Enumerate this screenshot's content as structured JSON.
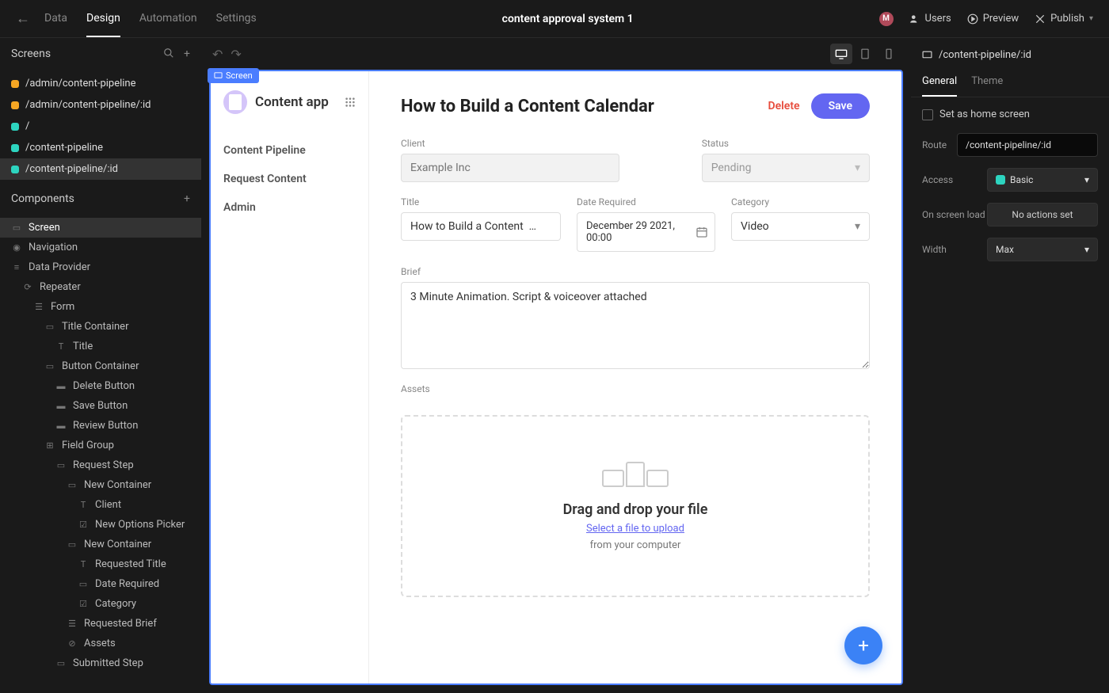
{
  "topbar": {
    "tabs": [
      "Data",
      "Design",
      "Automation",
      "Settings"
    ],
    "active_tab": "Design",
    "title": "content approval system 1",
    "avatar_initial": "M",
    "users_label": "Users",
    "preview_label": "Preview",
    "publish_label": "Publish"
  },
  "left": {
    "screens_header": "Screens",
    "screens": [
      {
        "label": "/admin/content-pipeline",
        "color": "orange"
      },
      {
        "label": "/admin/content-pipeline/:id",
        "color": "orange"
      },
      {
        "label": "/",
        "color": "teal"
      },
      {
        "label": "/content-pipeline",
        "color": "teal"
      },
      {
        "label": "/content-pipeline/:id",
        "color": "teal",
        "selected": true
      }
    ],
    "components_header": "Components",
    "components": [
      {
        "label": "Screen",
        "indent": 0,
        "icon": "▭",
        "selected": true
      },
      {
        "label": "Navigation",
        "indent": 0,
        "icon": "◉"
      },
      {
        "label": "Data Provider",
        "indent": 0,
        "icon": "≡"
      },
      {
        "label": "Repeater",
        "indent": 1,
        "icon": "⟳"
      },
      {
        "label": "Form",
        "indent": 2,
        "icon": "☰"
      },
      {
        "label": "Title Container",
        "indent": 3,
        "icon": "▭"
      },
      {
        "label": "Title",
        "indent": 4,
        "icon": "T"
      },
      {
        "label": "Button Container",
        "indent": 3,
        "icon": "▭"
      },
      {
        "label": "Delete Button",
        "indent": 4,
        "icon": "▬"
      },
      {
        "label": "Save Button",
        "indent": 4,
        "icon": "▬"
      },
      {
        "label": "Review Button",
        "indent": 4,
        "icon": "▬"
      },
      {
        "label": "Field Group",
        "indent": 3,
        "icon": "⊞"
      },
      {
        "label": "Request Step",
        "indent": 4,
        "icon": "▭"
      },
      {
        "label": "New Container",
        "indent": 5,
        "icon": "▭"
      },
      {
        "label": "Client",
        "indent": 6,
        "icon": "T"
      },
      {
        "label": "New Options Picker",
        "indent": 6,
        "icon": "☑"
      },
      {
        "label": "New Container",
        "indent": 5,
        "icon": "▭"
      },
      {
        "label": "Requested Title",
        "indent": 6,
        "icon": "T"
      },
      {
        "label": "Date Required",
        "indent": 6,
        "icon": "▭"
      },
      {
        "label": "Category",
        "indent": 6,
        "icon": "☑"
      },
      {
        "label": "Requested Brief",
        "indent": 5,
        "icon": "☰"
      },
      {
        "label": "Assets",
        "indent": 5,
        "icon": "⊘"
      },
      {
        "label": "Submitted Step",
        "indent": 4,
        "icon": "▭"
      }
    ]
  },
  "canvas": {
    "badge": "Screen",
    "app_name": "Content app",
    "nav_items": [
      "Content Pipeline",
      "Request Content",
      "Admin"
    ],
    "page_title": "How to Build a Content Calendar",
    "delete_btn": "Delete",
    "save_btn": "Save",
    "fields": {
      "client_label": "Client",
      "client_placeholder": "Example Inc",
      "status_label": "Status",
      "status_value": "Pending",
      "title_label": "Title",
      "title_value": "How to Build a Content  …",
      "date_label": "Date Required",
      "date_value": "December 29 2021, 00:00",
      "category_label": "Category",
      "category_value": "Video",
      "brief_label": "Brief",
      "brief_value": "3 Minute Animation. Script & voiceover attached",
      "assets_label": "Assets"
    },
    "dropzone": {
      "title": "Drag and drop your file",
      "link": "Select a file to upload",
      "sub": "from your computer"
    }
  },
  "right": {
    "path": "/content-pipeline/:id",
    "tabs": [
      "General",
      "Theme"
    ],
    "active_tab": "General",
    "home_checkbox": "Set as home screen",
    "route_label": "Route",
    "route_value": "/content-pipeline/:id",
    "access_label": "Access",
    "access_value": "Basic",
    "onload_label": "On screen load",
    "onload_value": "No actions set",
    "width_label": "Width",
    "width_value": "Max"
  }
}
